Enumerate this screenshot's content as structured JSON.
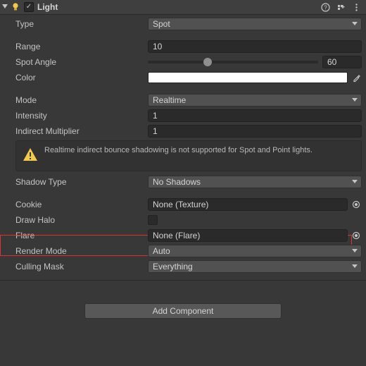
{
  "header": {
    "enabled": true,
    "title": "Light"
  },
  "fields": {
    "type": {
      "label": "Type",
      "value": "Spot"
    },
    "range": {
      "label": "Range",
      "value": "10"
    },
    "spotAngle": {
      "label": "Spot Angle",
      "value": "60",
      "min": 1,
      "max": 179,
      "percent": 35
    },
    "color": {
      "label": "Color",
      "hex": "#FFFFFF"
    },
    "mode": {
      "label": "Mode",
      "value": "Realtime"
    },
    "intensity": {
      "label": "Intensity",
      "value": "1"
    },
    "indirect": {
      "label": "Indirect Multiplier",
      "value": "1"
    },
    "warning": "Realtime indirect bounce shadowing is not supported for Spot and Point lights.",
    "shadowType": {
      "label": "Shadow Type",
      "value": "No Shadows"
    },
    "cookie": {
      "label": "Cookie",
      "value": "None (Texture)"
    },
    "drawHalo": {
      "label": "Draw Halo"
    },
    "flare": {
      "label": "Flare",
      "value": "None (Flare)"
    },
    "renderMode": {
      "label": "Render Mode",
      "value": "Auto"
    },
    "cullingMask": {
      "label": "Culling Mask",
      "value": "Everything"
    }
  },
  "addComponent": "Add Component"
}
